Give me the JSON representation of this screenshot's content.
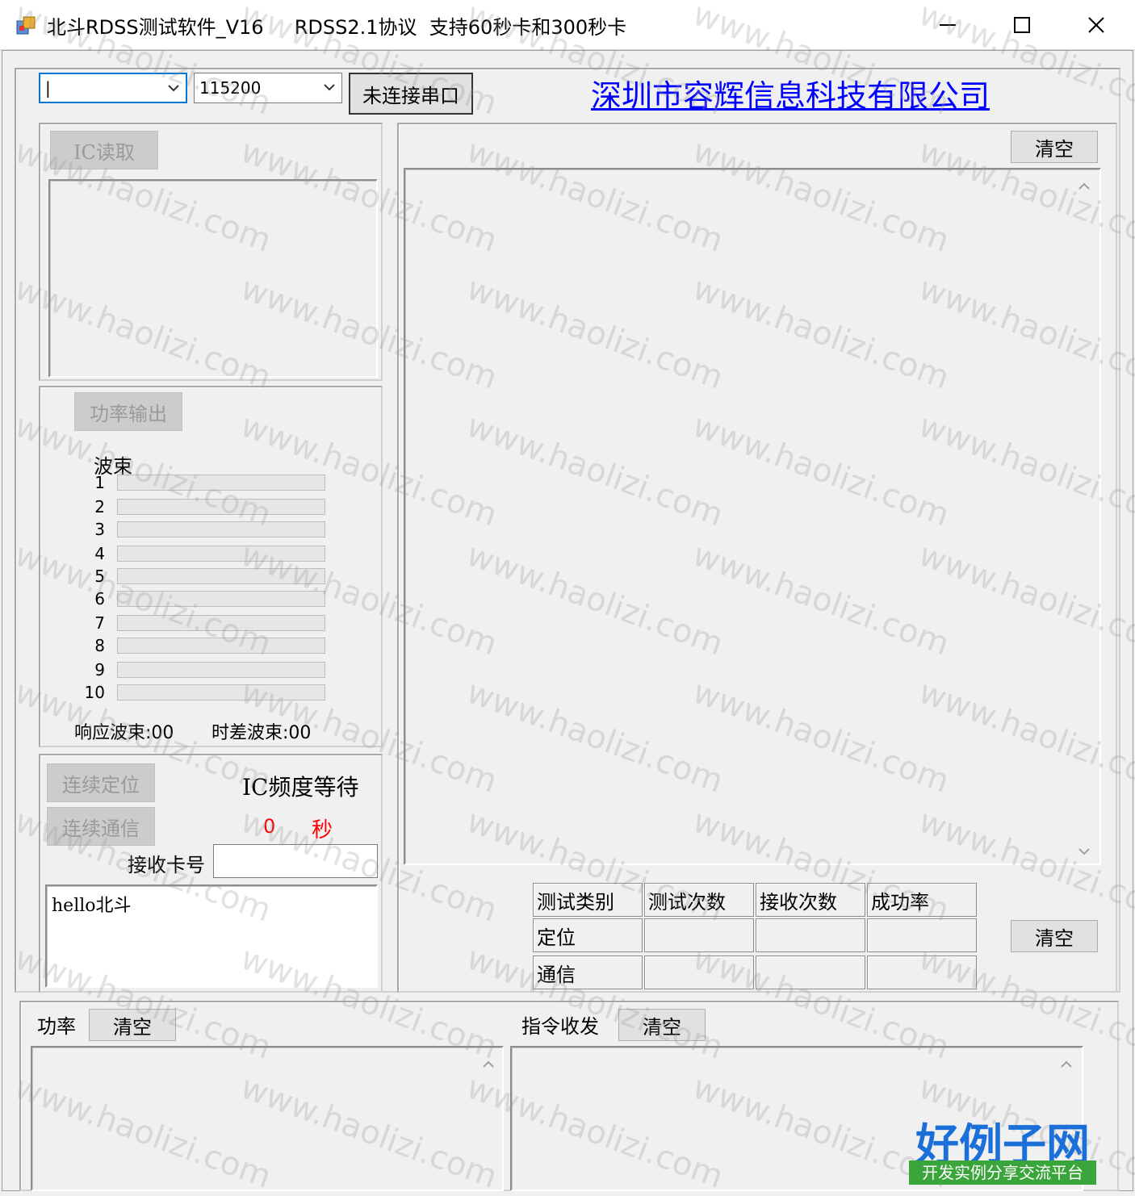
{
  "window": {
    "title": "北斗RDSS测试软件_V16     RDSS2.1协议  支持60秒卡和300秒卡",
    "controls": [
      "minimize",
      "maximize",
      "close"
    ]
  },
  "toolbar": {
    "port_value": "|",
    "baud_value": "115200",
    "connect_label": "未连接串口",
    "company_link": "深圳市容辉信息科技有限公司"
  },
  "ic_panel": {
    "read_label": "IC读取"
  },
  "power_panel": {
    "output_label": "功率输出",
    "beam_header": "波束",
    "beams": [
      "1",
      "2",
      "3",
      "4",
      "5",
      "6",
      "7",
      "8",
      "9",
      "10"
    ],
    "response_beam": "响应波束:00",
    "diff_beam": "时差波束:00"
  },
  "positioning_panel": {
    "continuous_position_label": "连续定位",
    "continuous_comm_label": "连续通信",
    "ic_wait_label": "IC频度等待",
    "wait_seconds": "0",
    "seconds_unit": "秒",
    "recv_card_label": "接收卡号",
    "recv_card_value": "",
    "message_text": "hello北斗"
  },
  "log_panel": {
    "clear_label": "清空"
  },
  "stats": {
    "headers": [
      "测试类别",
      "测试次数",
      "接收次数",
      "成功率"
    ],
    "rows": [
      [
        "定位",
        "",
        "",
        ""
      ],
      [
        "通信",
        "",
        "",
        ""
      ]
    ],
    "clear_label": "清空"
  },
  "bottom": {
    "power_label": "功率",
    "power_clear": "清空",
    "cmd_label": "指令收发",
    "cmd_clear": "清空"
  },
  "watermark": {
    "text": "www.haolizi.com",
    "logo_title": "好例子网",
    "logo_subtitle": "开发实例分享交流平台"
  },
  "colors": {
    "link": "#0000ff",
    "accent": "#0078d7",
    "warn": "#ff0000",
    "logo_blue": "#1a6fd8",
    "logo_green": "#3aa53a"
  }
}
